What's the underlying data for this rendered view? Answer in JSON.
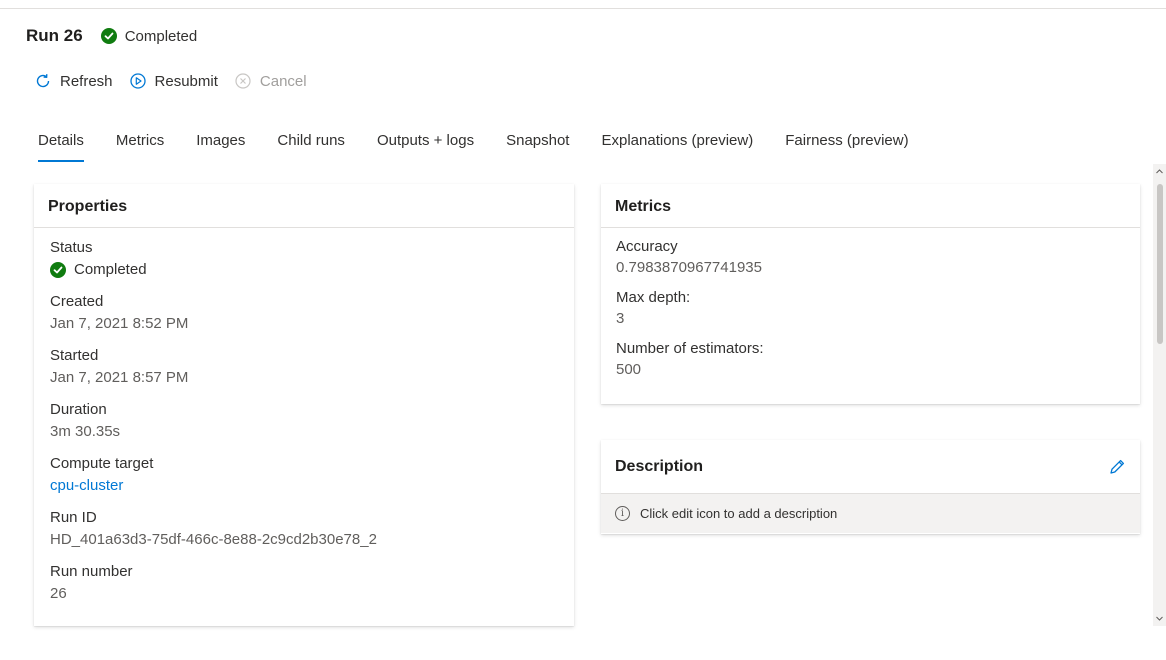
{
  "run": {
    "title": "Run 26",
    "status": "Completed"
  },
  "toolbar": {
    "refresh_label": "Refresh",
    "resubmit_label": "Resubmit",
    "cancel_label": "Cancel"
  },
  "tabs": [
    {
      "label": "Details",
      "active": true
    },
    {
      "label": "Metrics"
    },
    {
      "label": "Images"
    },
    {
      "label": "Child runs"
    },
    {
      "label": "Outputs + logs"
    },
    {
      "label": "Snapshot"
    },
    {
      "label": "Explanations (preview)"
    },
    {
      "label": "Fairness (preview)"
    }
  ],
  "properties": {
    "title": "Properties",
    "items": [
      {
        "label": "Status",
        "value": "Completed"
      },
      {
        "label": "Created",
        "value": "Jan 7, 2021 8:52 PM"
      },
      {
        "label": "Started",
        "value": "Jan 7, 2021 8:57 PM"
      },
      {
        "label": "Duration",
        "value": "3m 30.35s"
      },
      {
        "label": "Compute target",
        "value": "cpu-cluster"
      },
      {
        "label": "Run ID",
        "value": "HD_401a63d3-75df-466c-8e88-2c9cd2b30e78_2"
      },
      {
        "label": "Run number",
        "value": "26"
      }
    ]
  },
  "metrics": {
    "title": "Metrics",
    "items": [
      {
        "label": "Accuracy",
        "value": "0.7983870967741935"
      },
      {
        "label": "Max depth:",
        "value": "3"
      },
      {
        "label": "Number of estimators:",
        "value": "500"
      }
    ]
  },
  "description": {
    "title": "Description",
    "info": "Click edit icon to add a description"
  },
  "colors": {
    "accent": "#0078d4",
    "success": "#107c10"
  }
}
